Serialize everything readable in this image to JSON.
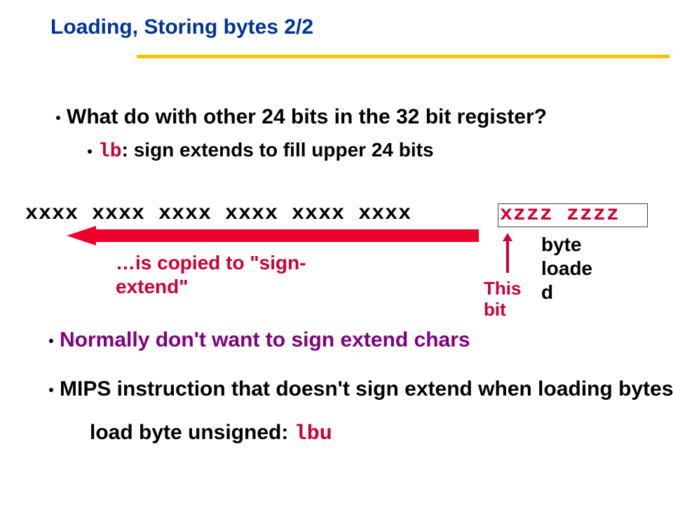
{
  "title": "Loading, Storing bytes 2/2",
  "bullets": {
    "q": "What do with other 24 bits in the 32 bit register?",
    "sub": {
      "lb": "lb",
      "rest": ": sign extends to fill upper 24 bits"
    },
    "normally": "Normally don't want to sign extend chars",
    "mips": "MIPS instruction that doesn't sign extend when loading bytes:",
    "lbu_line": {
      "pre": "load byte unsigned: ",
      "code": "lbu"
    }
  },
  "register": {
    "upper24": "xxxx xxxx xxxx xxxx xxxx xxxx",
    "byte": "xzzz zzzz"
  },
  "annotations": {
    "copied": "…is copied to \"sign-extend\"",
    "this_bit_line1": "This",
    "this_bit_line2": "bit",
    "byte_loaded_l1": "byte",
    "byte_loaded_l2": "loade",
    "byte_loaded_l3": "d"
  }
}
